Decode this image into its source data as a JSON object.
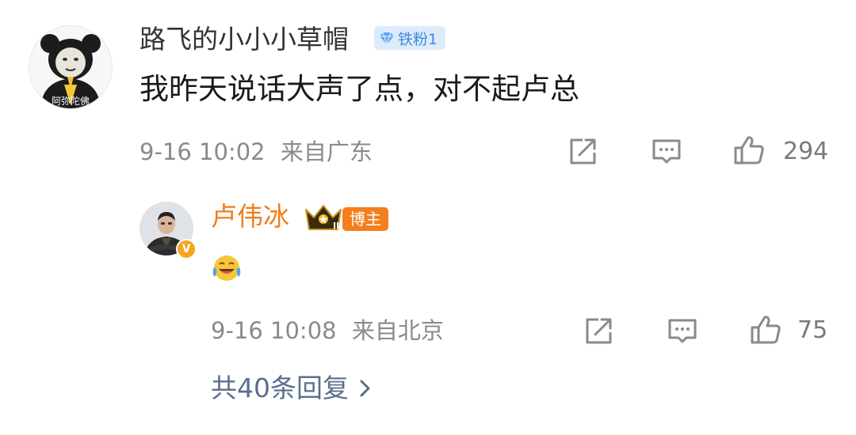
{
  "comment": {
    "username": "路飞的小小小草帽",
    "fan_badge": "铁粉1",
    "text": "我昨天说话大声了点，对不起卢总",
    "timestamp": "9-16 10:02",
    "location": "来自广东",
    "like_count": "294",
    "avatar_caption": "阿弥陀佛"
  },
  "reply": {
    "username": "卢伟冰",
    "badge": "博主",
    "crown_level": "II",
    "timestamp": "9-16 10:08",
    "location": "来自北京",
    "like_count": "75"
  },
  "footer": {
    "total_replies": "共40条回复"
  },
  "icons": {
    "share": "share-icon",
    "comment": "comment-icon",
    "like": "like-icon",
    "chevron": "chevron-right-icon",
    "emoji": "laugh-cry-emoji"
  },
  "colors": {
    "reply_username": "#f07d1c",
    "fan_badge_bg": "#dcecfb",
    "fan_badge_text": "#3e8ad9",
    "link": "#5a6f8c",
    "meta": "#8a8a8a"
  }
}
